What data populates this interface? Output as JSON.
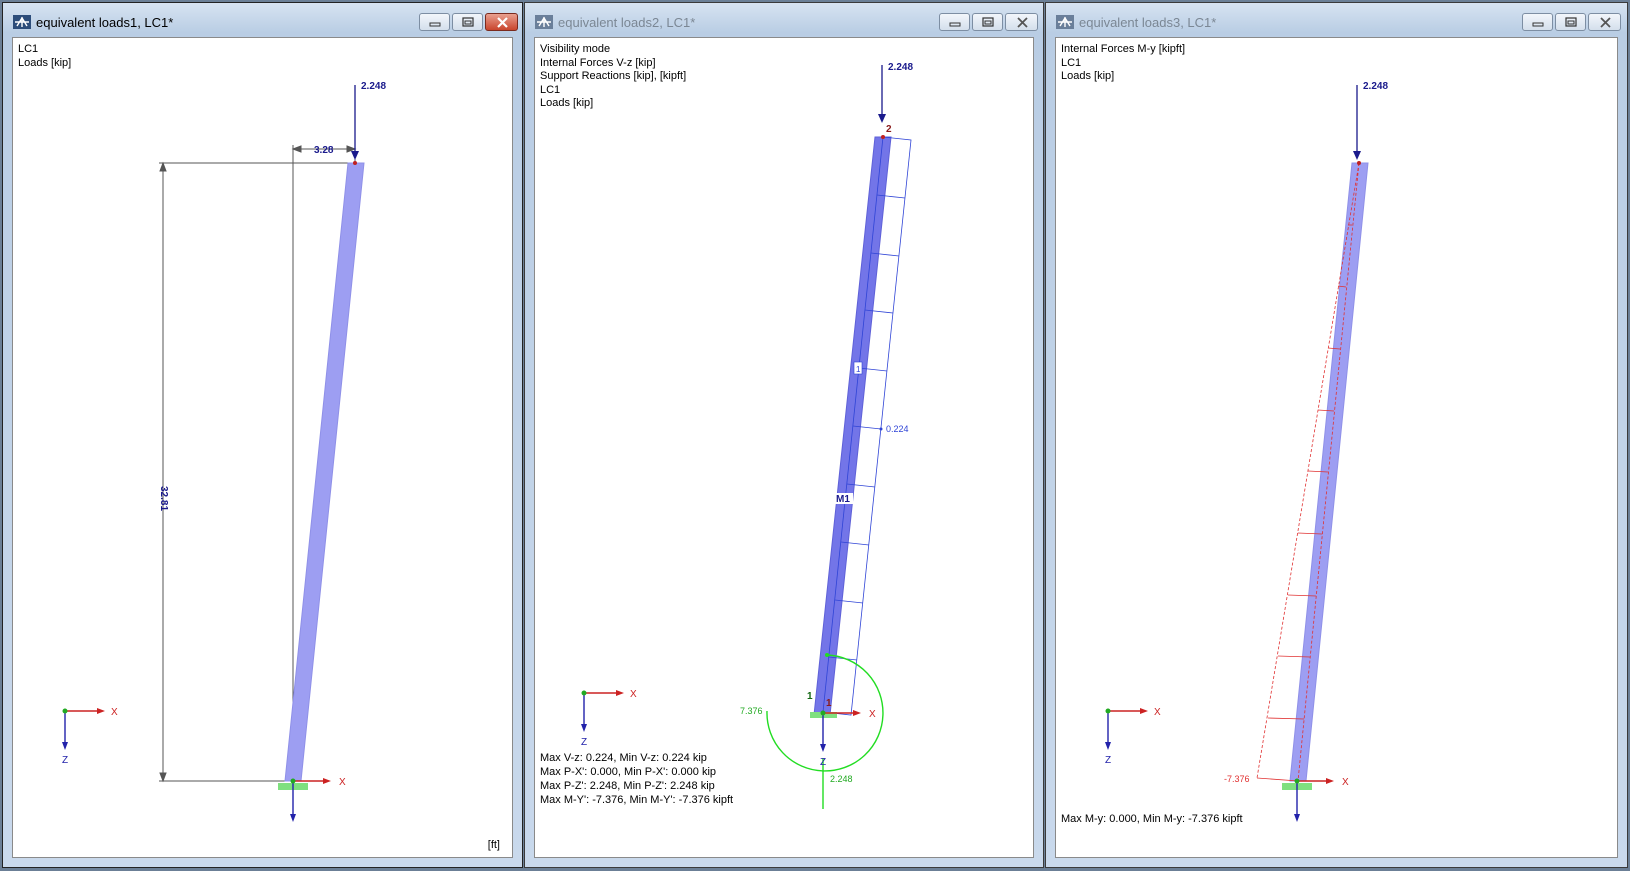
{
  "windows": [
    {
      "title": "equivalent loads1, LC1*",
      "info_lines": [
        "LC1",
        "Loads [kip]"
      ],
      "load_value": "2.248",
      "dim_horizontal": "3.28",
      "dim_vertical": "32.81",
      "axis_x": "X",
      "axis_z": "Z",
      "unit_label": "[ft]"
    },
    {
      "title": "equivalent loads2, LC1*",
      "info_lines": [
        "Visibility mode",
        "Internal Forces V-z [kip]",
        "Support Reactions [kip], [kipft]",
        "LC1",
        "Loads [kip]"
      ],
      "load_value": "2.248",
      "node_top": "2",
      "node_bottom": "1",
      "member_label": "M1",
      "member_number": "1",
      "shear_value": "0.224",
      "moment_reaction": "7.376",
      "vertical_reaction": "2.248",
      "support_number": "1",
      "axis_x": "X",
      "axis_z": "Z",
      "summary_lines": [
        "Max V-z: 0.224, Min V-z: 0.224 kip",
        "Max P-X': 0.000, Min P-X': 0.000 kip",
        "Max P-Z': 2.248, Min P-Z': 2.248 kip",
        "Max M-Y': -7.376, Min M-Y': -7.376 kipft"
      ]
    },
    {
      "title": "equivalent loads3, LC1*",
      "info_lines": [
        "Internal Forces M-y [kipft]",
        "LC1",
        "Loads [kip]"
      ],
      "load_value": "2.248",
      "moment_value": "-7.376",
      "axis_x": "X",
      "axis_z": "Z",
      "summary_lines": [
        "Max M-y: 0.000, Min M-y: -7.376 kipft"
      ]
    }
  ],
  "colors": {
    "member_fill": "#9d9ef2",
    "load_arrow": "#1a1a8c",
    "shear_diagram": "#2f44d6",
    "moment_diagram": "#e03030",
    "reaction": "#22dd22",
    "axis_x": "#cc2222",
    "axis_z": "#2222aa",
    "support": "#7fe07f"
  },
  "icons": [
    "app-icon",
    "minimize-icon",
    "restore-icon",
    "close-icon"
  ]
}
